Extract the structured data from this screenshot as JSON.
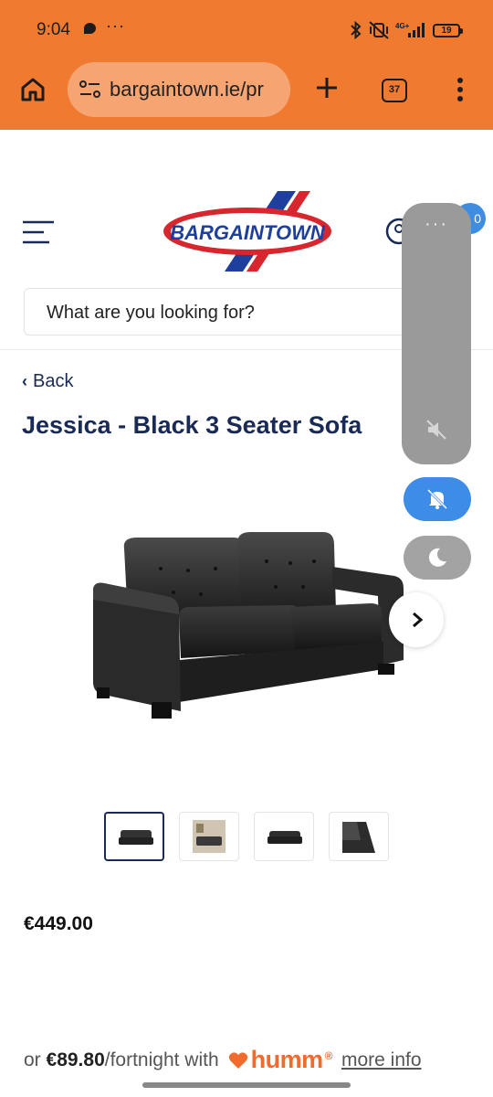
{
  "status_bar": {
    "time": "9:04",
    "dots": "···",
    "network": "4G+",
    "battery": "19",
    "icons": [
      "chat-bubble-icon",
      "bluetooth-icon",
      "vibrate-off-icon",
      "signal-icon",
      "battery-icon"
    ]
  },
  "browser": {
    "url": "bargaintown.ie/pr",
    "tab_count": "37",
    "theme_color": "#f07a30",
    "icons": [
      "home-icon",
      "site-settings-icon",
      "plus-icon",
      "tabs-icon",
      "more-vert-icon"
    ]
  },
  "site": {
    "logo_text": "BARGAINTOWN",
    "search_placeholder": "What are you looking for?",
    "back_label": "Back",
    "product_title": "Jessica - Black 3 Seater Sofa",
    "cart_count": "0",
    "brand_navy": "#1a2a57",
    "icons": [
      "hamburger-menu-icon",
      "account-icon",
      "chevron-right-icon"
    ]
  },
  "product": {
    "price": "€449.00",
    "thumbnails": [
      "sofa front view",
      "sofa in room",
      "sofa front small",
      "sofa detail"
    ],
    "selected_thumbnail": 0
  },
  "finance": {
    "prefix": "or ",
    "amount": "€89.80",
    "suffix": "/fortnight with",
    "provider": "humm",
    "provider_mark": "®",
    "more_info": "more info",
    "provider_color": "#f26a2e"
  },
  "floating_panel": {
    "dots": "···",
    "icons": [
      "mute-icon",
      "bell-off-icon",
      "moon-icon"
    ],
    "bell_color": "#3d8ce8"
  }
}
